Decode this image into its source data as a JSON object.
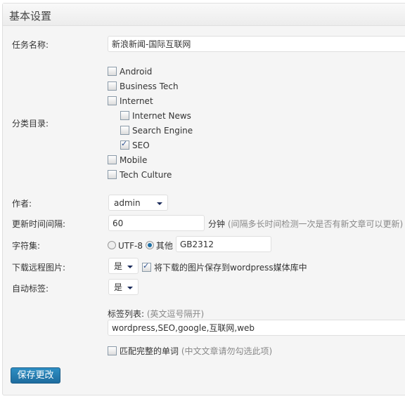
{
  "header": {
    "title": "基本设置"
  },
  "task_name": {
    "label": "任务名称:",
    "value": "新浪新闻-国际互联网"
  },
  "category": {
    "label": "分类目录:",
    "items": [
      {
        "label": "Android",
        "checked": false,
        "indent": 0
      },
      {
        "label": "Business Tech",
        "checked": false,
        "indent": 0
      },
      {
        "label": "Internet",
        "checked": false,
        "indent": 0
      },
      {
        "label": "Internet News",
        "checked": false,
        "indent": 1
      },
      {
        "label": "Search Engine",
        "checked": false,
        "indent": 1
      },
      {
        "label": "SEO",
        "checked": true,
        "indent": 1
      },
      {
        "label": "Mobile",
        "checked": false,
        "indent": 0
      },
      {
        "label": "Tech Culture",
        "checked": false,
        "indent": 0
      }
    ]
  },
  "author": {
    "label": "作者:",
    "value": "admin"
  },
  "interval": {
    "label": "更新时间间隔:",
    "value": "60",
    "unit": "分钟",
    "hint": "(间隔多长时间检测一次是否有新文章可以更新)"
  },
  "charset": {
    "label": "字符集:",
    "utf8": "UTF-8",
    "other": "其他",
    "selected": "其他",
    "value": "GB2312"
  },
  "download": {
    "label": "下载远程图片:",
    "value": "是",
    "save_label": "将下载的图片保存到wordpress媒体库中",
    "save_checked": true
  },
  "autotag": {
    "label": "自动标签:",
    "value": "是",
    "list_label": "标签列表:",
    "list_hint": "(英文逗号隔开)",
    "list_value": "wordpress,SEO,google,互联网,web",
    "match_label": "匹配完整的单词",
    "match_hint": "(中文文章请勿勾选此项)",
    "match_checked": false
  },
  "save_button": "保存更改"
}
